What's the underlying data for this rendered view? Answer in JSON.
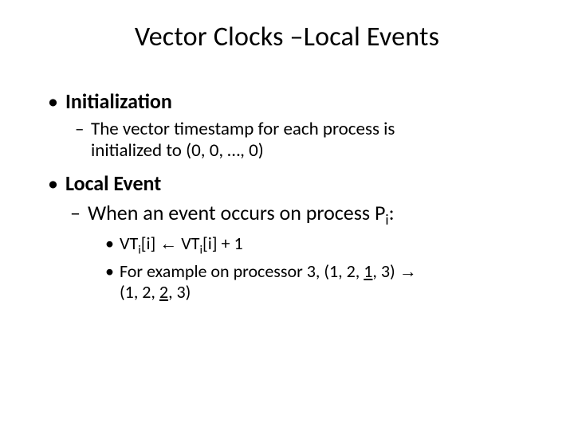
{
  "title": "Vector Clocks –Local Events",
  "b1": "Initialization",
  "b1_1a": "The vector timestamp for each process is",
  "b1_1b": "initialized to (0, 0, …, 0)",
  "b2": "Local Event",
  "b2_1a": "When an event occurs on process P",
  "b2_1_sub": "i",
  "b2_1b": ":",
  "vt_a": "VT",
  "vt_b": "[i] ",
  "arrow_l": "←",
  "vt_c": " VT",
  "vt_d": "[i] + 1",
  "ex_a": "For example on processor 3, (1, 2, ",
  "ex_u1": "1",
  "ex_b": ", 3) ",
  "arrow_r": "→",
  "ex_c": "(1, 2, ",
  "ex_u2": "2",
  "ex_d": ", 3)"
}
